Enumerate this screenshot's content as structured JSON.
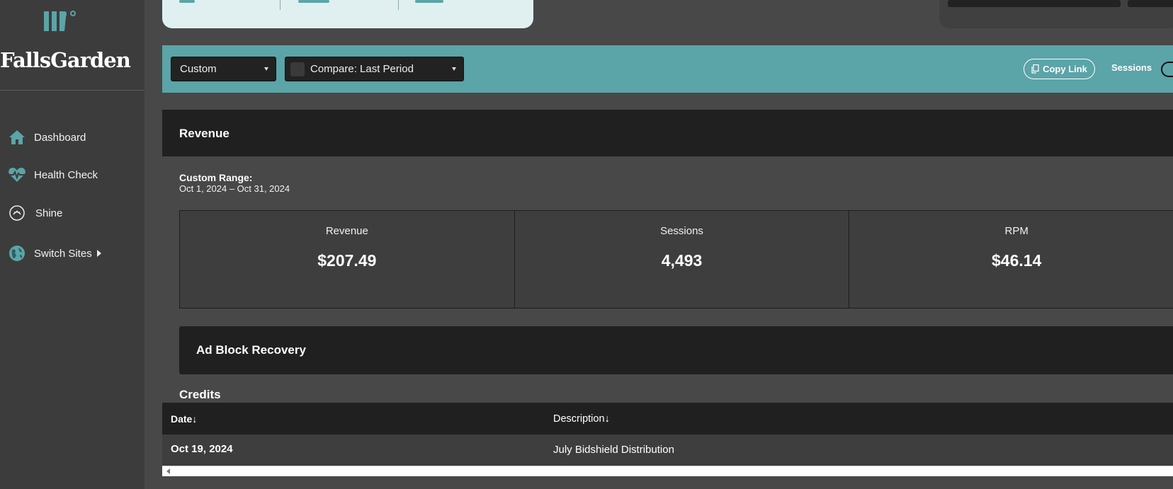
{
  "sidebar": {
    "brand": "FallsGarden",
    "items": [
      {
        "label": "Dashboard",
        "icon": "home-icon"
      },
      {
        "label": "Health Check",
        "icon": "heartbeat-icon"
      },
      {
        "label": "Shine",
        "icon": "shine-icon"
      },
      {
        "label": "Switch Sites",
        "icon": "globe-icon"
      }
    ]
  },
  "toolbar": {
    "date_select": "Custom",
    "compare_select": "Compare: Last Period",
    "copy_link": "Copy Link",
    "sessions_label": "Sessions"
  },
  "revenue": {
    "title": "Revenue",
    "range_label": "Custom Range:",
    "range_value": "Oct 1, 2024 – Oct 31, 2024",
    "stats": [
      {
        "label": "Revenue",
        "value": "$207.49"
      },
      {
        "label": "Sessions",
        "value": "4,493"
      },
      {
        "label": "RPM",
        "value": "$46.14"
      }
    ]
  },
  "ad_block": {
    "title": "Ad Block Recovery"
  },
  "credits": {
    "title": "Credits",
    "columns": [
      "Date↓",
      "Description↓"
    ],
    "rows": [
      {
        "date": "Oct 19, 2024",
        "description": "July Bidshield Distribution"
      }
    ]
  },
  "colors": {
    "accent": "#5ba4a8",
    "sidebar_bg": "#3c3c3c",
    "panel_dark": "#202020"
  }
}
